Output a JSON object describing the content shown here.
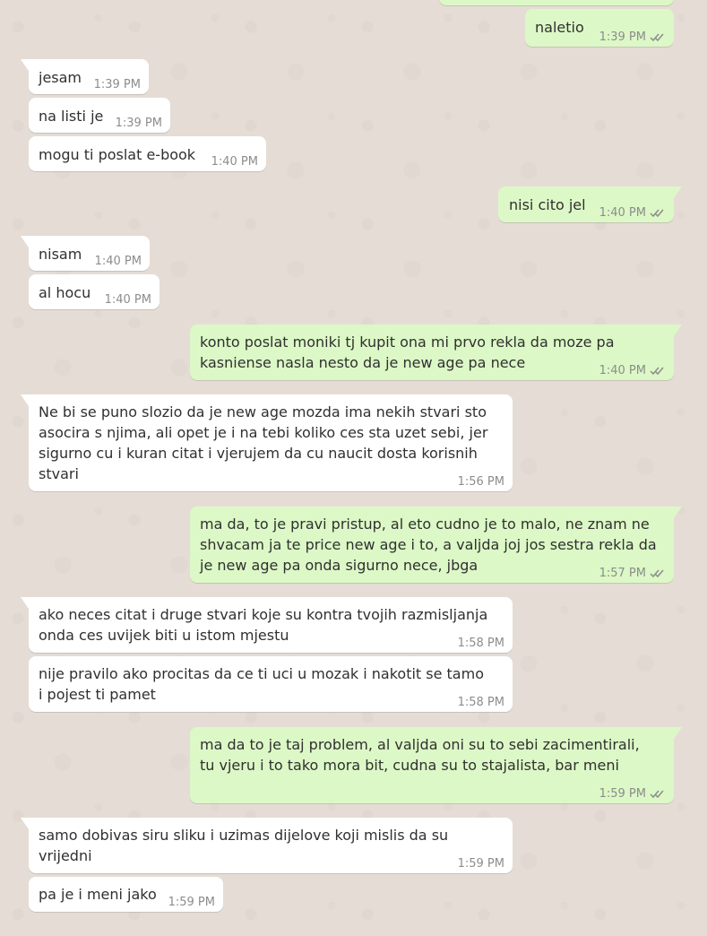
{
  "chat": {
    "messages": [
      {
        "dir": "out",
        "text": "",
        "time": "",
        "read": true
      },
      {
        "dir": "out",
        "text": "naletio",
        "time": "1:39 PM",
        "read": true
      },
      {
        "dir": "in",
        "text": "jesam",
        "time": "1:39 PM"
      },
      {
        "dir": "in",
        "text": "na listi je",
        "time": "1:39 PM"
      },
      {
        "dir": "in",
        "text": "mogu ti poslat e-book",
        "time": "1:40 PM"
      },
      {
        "dir": "out",
        "text": "nisi cito jel",
        "time": "1:40 PM",
        "read": true
      },
      {
        "dir": "in",
        "text": "nisam",
        "time": "1:40 PM"
      },
      {
        "dir": "in",
        "text": "al hocu",
        "time": "1:40 PM"
      },
      {
        "dir": "out",
        "text": "konto poslat moniki tj kupit ona mi prvo rekla da moze pa kasniense nasla nesto da je new age pa nece",
        "time": "1:40 PM",
        "read": true
      },
      {
        "dir": "in",
        "text": "Ne bi se puno slozio da je new age mozda ima nekih stvari sto asocira s njima, ali opet je i na tebi koliko ces sta uzet sebi, jer sigurno cu i kuran citat i vjerujem da cu naucit dosta korisnih stvari",
        "time": "1:56 PM"
      },
      {
        "dir": "out",
        "text": "ma da, to je pravi pristup, al eto cudno je to malo, ne znam ne shvacam ja te price new age i to, a valjda joj jos sestra rekla da je new age pa onda sigurno nece, jbga",
        "time": "1:57 PM",
        "read": true
      },
      {
        "dir": "in",
        "text": "ako neces citat i druge stvari koje su kontra tvojih razmisljanja onda ces uvijek biti u istom mjestu",
        "time": "1:58 PM"
      },
      {
        "dir": "in",
        "text": "nije pravilo ako procitas da ce ti uci u mozak i nakotit se tamo i pojest ti pamet",
        "time": "1:58 PM"
      },
      {
        "dir": "out",
        "text": "ma da to je taj problem, al valjda oni su to sebi zacimentirali, tu vjeru i to tako mora bit, cudna su to stajalista, bar meni",
        "time": "1:59 PM",
        "read": true
      },
      {
        "dir": "in",
        "text": "samo dobivas siru sliku i uzimas dijelove koji mislis da su vrijedni",
        "time": "1:59 PM"
      },
      {
        "dir": "in",
        "text": "pa je i meni jako",
        "time": "1:59 PM"
      }
    ]
  },
  "colors": {
    "background": "#e5ddd5",
    "incoming_bubble": "#ffffff",
    "outgoing_bubble": "#dcf8c6",
    "text": "#303030",
    "meta": "#8c8c8c",
    "read_ticks": "#8c8c8c"
  },
  "icons": {
    "read_receipt": "double-check-icon"
  }
}
